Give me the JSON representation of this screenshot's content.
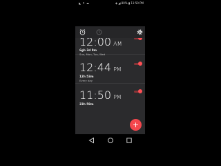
{
  "status_bar": {
    "left_icons": [
      "n-icon",
      "arrow-icon",
      "cloud-icon"
    ],
    "battery": "80%",
    "time": "11:50 PM"
  },
  "toolbar": {
    "tabs": [
      "alarm-clock-icon",
      "clock-icon"
    ],
    "settings_icon": "gear-icon"
  },
  "alarms": [
    {
      "time": "12:00",
      "ampm": "AM",
      "remaining": "6gh 3d 9m",
      "repeat": "Sun, Mon, Tue, Wed",
      "enabled": true
    },
    {
      "time": "12:44",
      "ampm": "PM",
      "remaining": "12h 53m",
      "repeat": "Every day",
      "enabled": true
    },
    {
      "time": "11:50",
      "ampm": "PM",
      "remaining": "23h 59m",
      "repeat": "",
      "enabled": true
    }
  ],
  "fab": {
    "label": "+"
  },
  "colors": {
    "accent": "#f4474d",
    "panel": "#2b2b2d",
    "background": "#000000"
  },
  "nav_bar": {
    "items": [
      "back-icon",
      "home-icon",
      "recents-icon"
    ]
  }
}
